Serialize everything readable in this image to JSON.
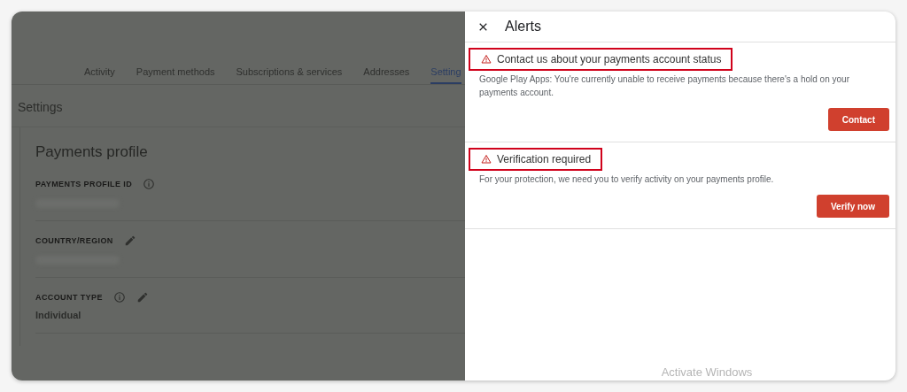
{
  "background_page": {
    "tabs": [
      {
        "label": "Activity",
        "selected": false
      },
      {
        "label": "Payment methods",
        "selected": false
      },
      {
        "label": "Subscriptions & services",
        "selected": false
      },
      {
        "label": "Addresses",
        "selected": false
      },
      {
        "label": "Setting",
        "selected": true
      }
    ],
    "section_title": "Settings",
    "card": {
      "title": "Payments profile",
      "fields": [
        {
          "label": "PAYMENTS PROFILE ID",
          "info": true,
          "editable": false,
          "value_hidden": true
        },
        {
          "label": "COUNTRY/REGION",
          "info": false,
          "editable": true,
          "value_hidden": true
        },
        {
          "label": "ACCOUNT TYPE",
          "info": true,
          "editable": true,
          "value": "Individual"
        }
      ]
    }
  },
  "alerts_panel": {
    "title": "Alerts",
    "alerts": [
      {
        "title": "Contact us about your payments account status",
        "highlighted": true,
        "message": "Google Play Apps: You're currently unable to receive payments because there's a hold on your payments account.",
        "button": "Contact"
      },
      {
        "title": "Verification required",
        "highlighted": true,
        "message": "For your protection, we need you to verify activity on your payments profile.",
        "button": "Verify now"
      }
    ]
  },
  "os_notice": "Activate Windows"
}
